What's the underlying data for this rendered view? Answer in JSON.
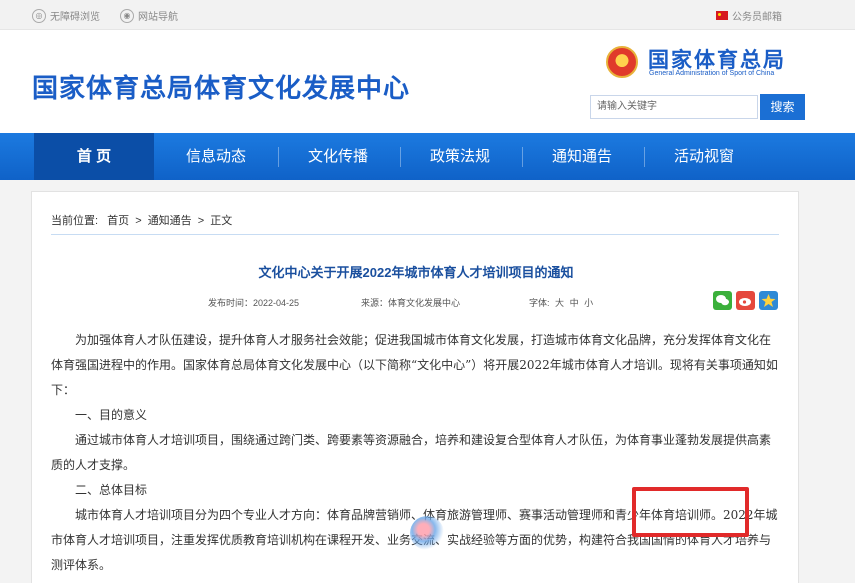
{
  "topbar": {
    "accessibility_label": "无障碍浏览",
    "site_nav_label": "网站导航",
    "mail_label": "公务员邮箱"
  },
  "header": {
    "site_title": "国家体育总局体育文化发展中心",
    "org_name": "国家体育总局",
    "org_name_en": "General Administration of Sport of China",
    "search_placeholder": "请输入关键字",
    "search_button": "搜索"
  },
  "nav": {
    "items": [
      {
        "label": "首 页"
      },
      {
        "label": "信息动态"
      },
      {
        "label": "文化传播"
      },
      {
        "label": "政策法规"
      },
      {
        "label": "通知通告"
      },
      {
        "label": "活动视窗"
      }
    ],
    "active_index": 0
  },
  "breadcrumb": {
    "prefix": "当前位置:",
    "home": "首页",
    "section": "通知通告",
    "current": "正文",
    "separator": ">"
  },
  "article": {
    "title": "文化中心关于开展2022年城市体育人才培训项目的通知",
    "publish_time": "发布时间：2022-04-25",
    "source": "来源：体育文化发展中心",
    "font_label": "字体:",
    "font_large": "大",
    "font_medium": "中",
    "font_small": "小",
    "paragraphs": [
      "为加强体育人才队伍建设，提升体育人才服务社会效能；促进我国城市体育文化发展，打造城市体育文化品牌，充分发挥体育文化在体育强国进程中的作用。国家体育总局体育文化发展中心（以下简称“文化中心”）将开展2022年城市体育人才培训。现将有关事项通知如下：",
      "一、目的意义",
      "通过城市体育人才培训项目，围绕通过跨门类、跨要素等资源融合，培养和建设复合型体育人才队伍，为体育事业蓬勃发展提供高素质的人才支撑。",
      "二、总体目标",
      "城市体育人才培训项目分为四个专业人才方向：体育品牌营销师、体育旅游管理师、赛事活动管理师和青少年体育培训师。2022年城市体育人才培训项目，注重发挥优质教育培训机构在课程开发、业务交流、实战经验等方面的优势，构建符合我国国情的体育人才培养与测评体系。"
    ]
  },
  "share": {
    "icons": [
      "wechat-icon",
      "weibo-icon",
      "qzone-icon"
    ]
  },
  "colors": {
    "brand_blue": "#1a5dc6",
    "nav_blue": "#1b6fd4",
    "nav_active": "#0b4ea7",
    "highlight_red": "#e12a2a"
  }
}
